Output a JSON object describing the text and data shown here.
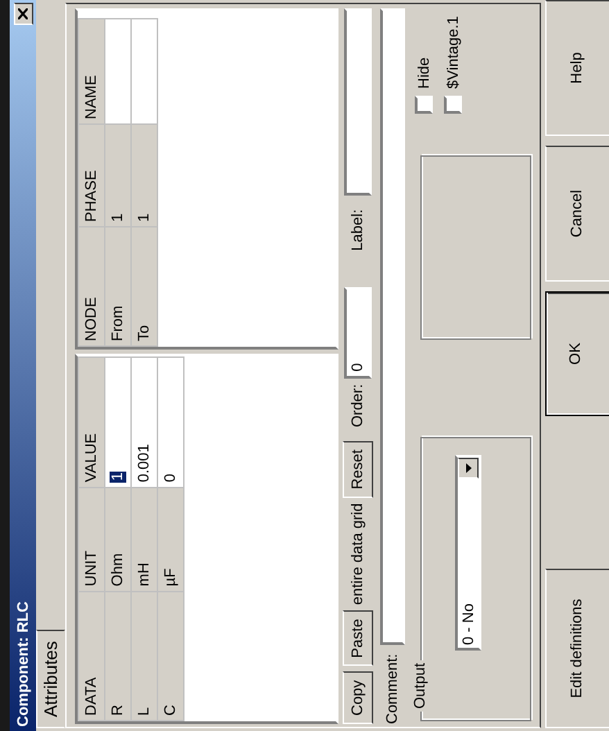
{
  "window": {
    "title": "Component: RLC"
  },
  "tabs": [
    {
      "label": "Attributes",
      "selected": true
    }
  ],
  "data_grid": {
    "columns": [
      "DATA",
      "UNIT",
      "VALUE"
    ],
    "rows": [
      {
        "data": "R",
        "unit": "Ohm",
        "value": "1",
        "selected": true
      },
      {
        "data": "L",
        "unit": "mH",
        "value": "0.001",
        "selected": false
      },
      {
        "data": "C",
        "unit": "µF",
        "value": "0",
        "selected": false
      }
    ]
  },
  "node_grid": {
    "columns": [
      "NODE",
      "PHASE",
      "NAME"
    ],
    "rows": [
      {
        "node": "From",
        "phase": "1"
      },
      {
        "node": "To",
        "phase": "1"
      }
    ]
  },
  "grid_buttons": [
    "Copy",
    "Paste"
  ],
  "grid_note": "entire data grid",
  "reset_button": "Reset",
  "order": {
    "label": "Order:",
    "value": "0"
  },
  "label_field": {
    "label": "Label:"
  },
  "comment": {
    "label": "Comment:"
  },
  "output": {
    "label": "Output",
    "dropdown": "0 - No"
  },
  "checkboxes": [
    {
      "label": "Hide",
      "checked": false
    },
    {
      "label": "$Vintage.1",
      "checked": false
    }
  ],
  "buttons": [
    {
      "label": "Edit definitions",
      "default": false
    },
    {
      "label": "OK",
      "default": true
    },
    {
      "label": "Cancel",
      "default": false
    },
    {
      "label": "Help",
      "default": false
    }
  ]
}
